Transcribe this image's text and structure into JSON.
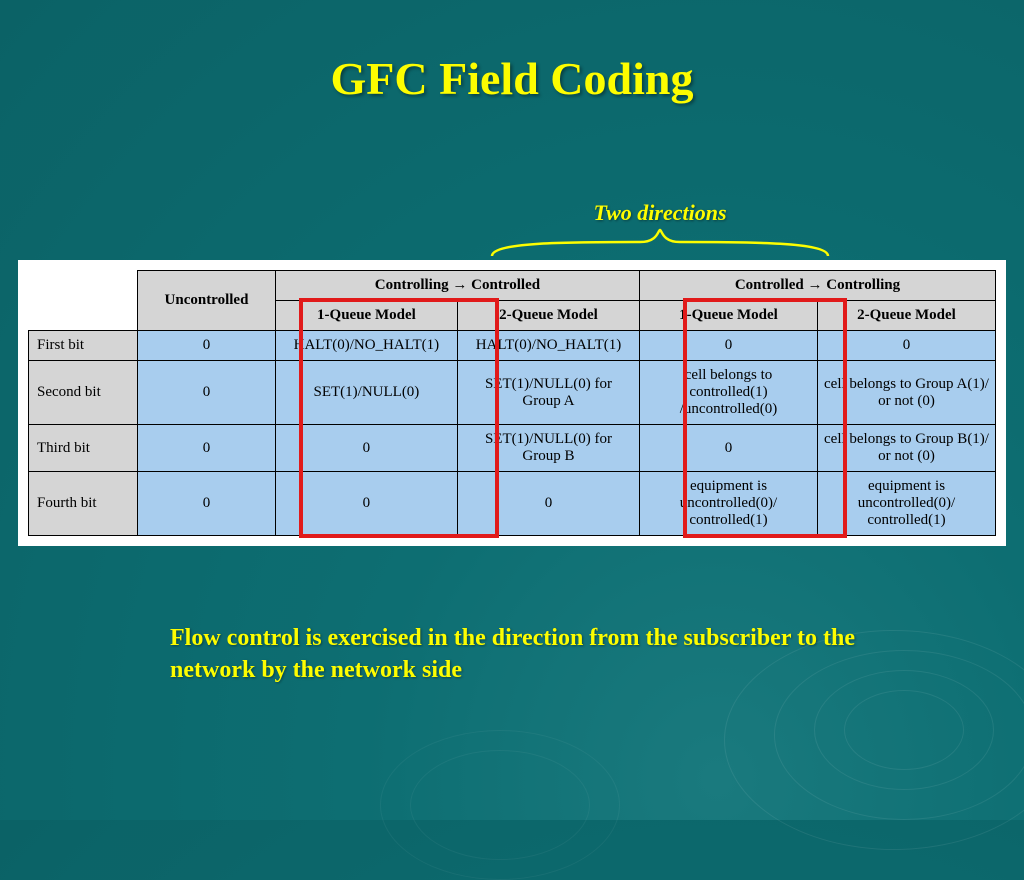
{
  "title": "GFC Field Coding",
  "annotation": "Two directions",
  "caption": "Flow control is exercised in the direction from the subscriber to the network by the network side",
  "headers": {
    "uncontrolled": "Uncontrolled",
    "dir1": "Controlling → Controlled",
    "dir2": "Controlled → Controlling",
    "q1": "1-Queue Model",
    "q2": "2-Queue Model"
  },
  "rows": [
    {
      "label": "First bit",
      "uncontrolled": "0",
      "d1q1": "HALT(0)/NO_HALT(1)",
      "d1q2": "HALT(0)/NO_HALT(1)",
      "d2q1": "0",
      "d2q2": "0"
    },
    {
      "label": "Second bit",
      "uncontrolled": "0",
      "d1q1": "SET(1)/NULL(0)",
      "d1q2": "SET(1)/NULL(0) for Group A",
      "d2q1": "cell belongs to controlled(1) /uncontrolled(0)",
      "d2q2": "cell belongs to Group A(1)/ or not (0)"
    },
    {
      "label": "Third bit",
      "uncontrolled": "0",
      "d1q1": "0",
      "d1q2": "SET(1)/NULL(0) for Group B",
      "d2q1": "0",
      "d2q2": "cell belongs to Group B(1)/ or not (0)"
    },
    {
      "label": "Fourth bit",
      "uncontrolled": "0",
      "d1q1": "0",
      "d1q2": "0",
      "d2q1": "equipment is uncontrolled(0)/ controlled(1)",
      "d2q2": "equipment is uncontrolled(0)/ controlled(1)"
    }
  ]
}
